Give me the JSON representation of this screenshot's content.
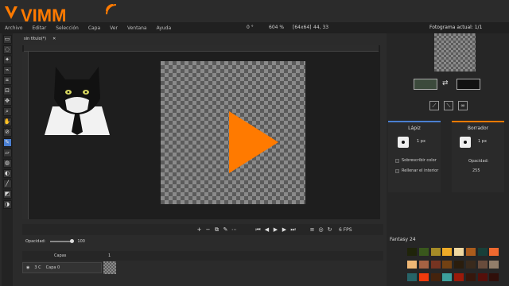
{
  "logo": {
    "text": "VIMM",
    "accent": "#ff7a00"
  },
  "menu": {
    "items": [
      "Archivo",
      "Editar",
      "Selección",
      "Capa",
      "Ver",
      "Ventana",
      "Ayuda"
    ],
    "angle": "0 °",
    "zoom": "604 %",
    "canvas_size": "[64x64]",
    "cursor": "44, 33"
  },
  "document": {
    "tab_title": "sin título(*)",
    "close": "✕"
  },
  "timeline": {
    "fps": "6 FPS",
    "opacity_label": "Opacidad:",
    "opacity_value": "100"
  },
  "layers": {
    "header": "Capas",
    "layer_name": "Capa 0",
    "layer_flags": "3 C",
    "count": "1"
  },
  "right_panel": {
    "frame_label": "Fotograma actual:",
    "frame_value": "1/1",
    "primary_color": "#3c4a3c",
    "secondary_color": "#111111",
    "pencil": {
      "title": "Lápiz",
      "size": "1 px",
      "overwrite_label": "Sobrescribir color",
      "fill_label": "Rellenar el interior",
      "accent": "#4a7fd1"
    },
    "eraser": {
      "title": "Borrador",
      "size": "1 px",
      "opacity_label": "Opacidad:",
      "opacity_value": "255",
      "accent": "#ff7a00"
    },
    "palette_name": "Fantasy 24",
    "palette": [
      "#1f240a",
      "#39571c",
      "#a58c27",
      "#efac28",
      "#efd8a1",
      "#ab5c1c",
      "#183f39",
      "#ef692f",
      "#efb775",
      "#a56243",
      "#773421",
      "#724113",
      "#2a1d0d",
      "#392a1c",
      "#684c3c",
      "#927e6a",
      "#276468",
      "#ef3a0c",
      "#45230d",
      "#3c9f9c",
      "#9b1a0a",
      "#36170c",
      "#550f0a",
      "#300f0a"
    ]
  }
}
